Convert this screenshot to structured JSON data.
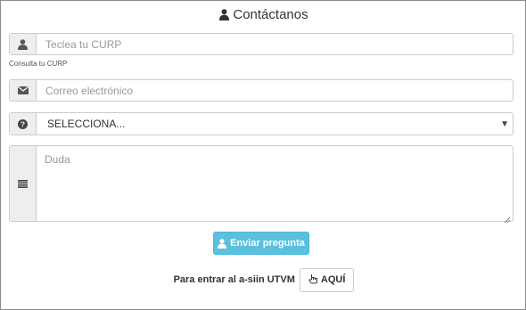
{
  "header": {
    "title": "Contáctanos",
    "icon": "user-icon"
  },
  "curp": {
    "placeholder": "Teclea tu CURP",
    "value": "",
    "icon": "user-icon",
    "hint": "Consulta tu CURP"
  },
  "email": {
    "placeholder": "Correo electrónico",
    "value": "",
    "icon": "envelope-icon"
  },
  "topic": {
    "selected": "SELECCIONA...",
    "icon": "question-circle-icon"
  },
  "question": {
    "placeholder": "Duda",
    "value": "",
    "icon": "lines-icon"
  },
  "submit": {
    "label": "Enviar pregunta",
    "icon": "user-icon",
    "color": "#5bc0de"
  },
  "portal": {
    "label": "Para entrar al a-siin UTVM",
    "button_label": "AQUÍ",
    "icon": "hand-pointer-icon"
  }
}
